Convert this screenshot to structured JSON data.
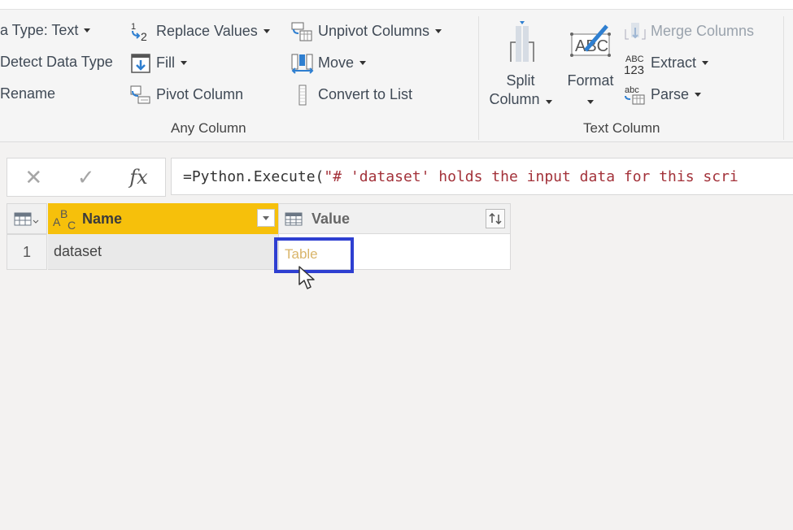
{
  "ribbon": {
    "any_column": {
      "label": "Any Column",
      "data_type": "a Type: Text",
      "detect_data_type": "Detect Data Type",
      "rename": "Rename",
      "replace_values": "Replace Values",
      "fill": "Fill",
      "pivot_column": "Pivot Column",
      "unpivot_columns": "Unpivot Columns",
      "move": "Move",
      "convert_to_list": "Convert to List"
    },
    "text_column": {
      "label": "Text Column",
      "split_column_1": "Split",
      "split_column_2": "Column",
      "format": "Format",
      "merge_columns": "Merge Columns",
      "extract": "Extract",
      "parse": "Parse"
    }
  },
  "formula_bar": {
    "cancel_icon": "close-icon",
    "commit_icon": "check-icon",
    "fx_label": "fx",
    "eq": "= ",
    "func": "Python.Execute(",
    "string": "\"# 'dataset' holds the input data for this scri"
  },
  "grid": {
    "columns": [
      {
        "type_icon": "ABC",
        "name": "Name"
      },
      {
        "type_icon": "table-icon",
        "name": "Value"
      }
    ],
    "rows": [
      {
        "num": "1",
        "name": "dataset",
        "value": "Table"
      }
    ]
  },
  "colors": {
    "selected_header": "#f6c00b",
    "highlight_box": "#2e3fd1",
    "table_link": "#d9b56a",
    "formula_string": "#a3323a"
  }
}
